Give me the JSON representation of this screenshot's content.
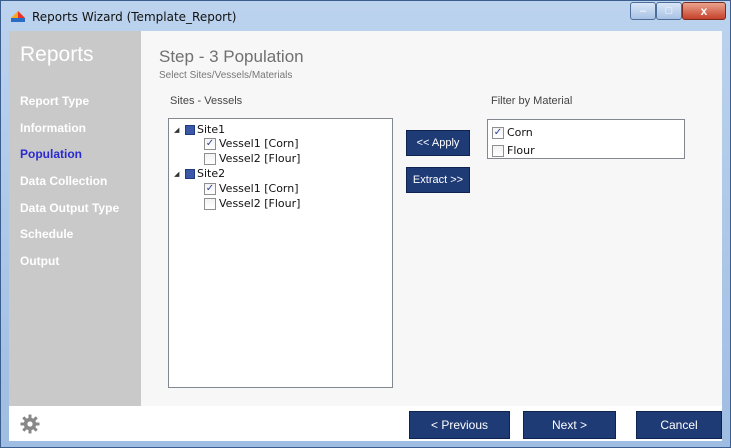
{
  "window": {
    "title": "Reports Wizard (Template_Report)",
    "minimize": "–",
    "maximize": "□",
    "close": "x"
  },
  "sidebar": {
    "title": "Reports",
    "items": [
      {
        "label": "Report Type"
      },
      {
        "label": "Information"
      },
      {
        "label": "Population"
      },
      {
        "label": "Data Collection"
      },
      {
        "label": "Data Output Type"
      },
      {
        "label": "Schedule"
      },
      {
        "label": "Output"
      }
    ],
    "active_index": 2
  },
  "step": {
    "title": "Step - 3  Population",
    "subtitle": "Select Sites/Vessels/Materials"
  },
  "sites": {
    "label": "Sites - Vessels",
    "tree": [
      {
        "label": "Site1",
        "children": [
          {
            "label": "Vessel1 [Corn]",
            "checked": true
          },
          {
            "label": "Vessel2 [Flour]",
            "checked": false
          }
        ]
      },
      {
        "label": "Site2",
        "children": [
          {
            "label": "Vessel1 [Corn]",
            "checked": true
          },
          {
            "label": "Vessel2 [Flour]",
            "checked": false
          }
        ]
      }
    ]
  },
  "actions": {
    "apply": "<< Apply",
    "extract": "Extract >>"
  },
  "filter": {
    "label": "Filter by Material",
    "items": [
      {
        "label": "Corn",
        "checked": true
      },
      {
        "label": "Flour",
        "checked": false
      }
    ]
  },
  "footer": {
    "previous": "< Previous",
    "next": "Next >",
    "cancel": "Cancel"
  },
  "colors": {
    "nav_active": "#2a2ad0",
    "button_bg": "#1f3b75",
    "sidebar_bg": "#c9c9c9"
  },
  "icons": {
    "app": "pie-chart-icon",
    "settings": "gear-icon",
    "tree_expander": "triangle-down-icon",
    "tree_node": "square-icon",
    "check": "checkmark-icon"
  }
}
